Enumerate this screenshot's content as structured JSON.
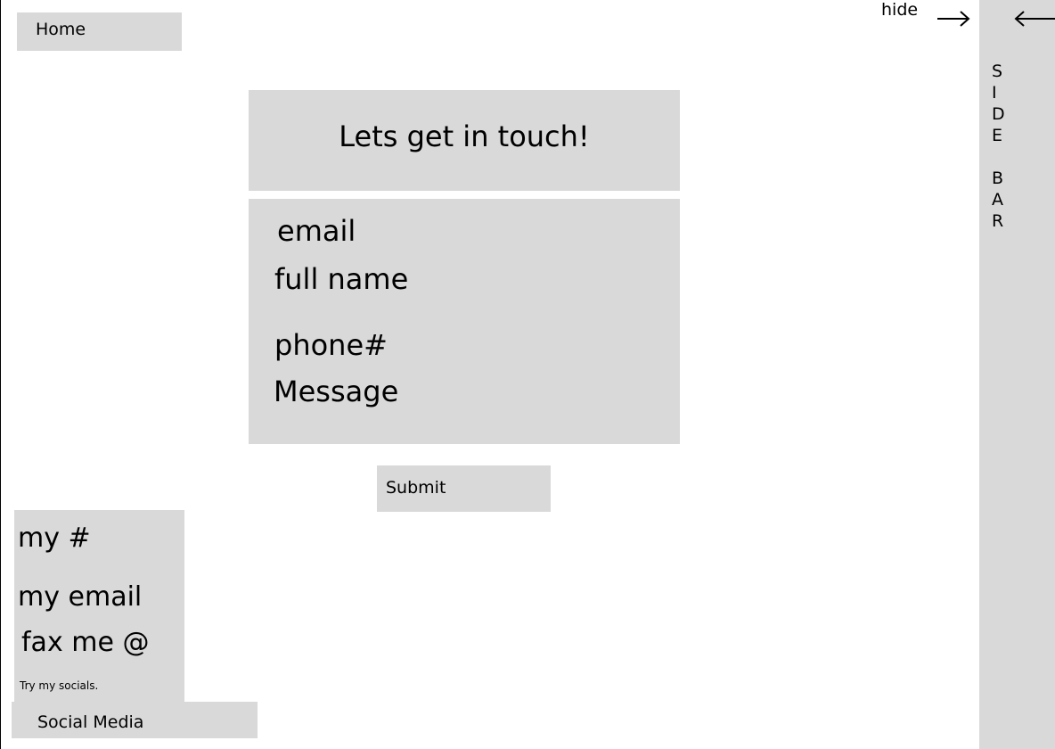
{
  "nav": {
    "home_label": "Home",
    "hide_label": "hide"
  },
  "contact_form": {
    "title": "Lets get in touch!",
    "fields": {
      "email": "email",
      "full_name": "full name",
      "phone": "phone#",
      "message": "Message"
    },
    "submit_label": "Submit"
  },
  "contact_info": {
    "my_number": "my #",
    "my_email": "my email",
    "fax": "fax me @",
    "socials_note": "Try my socials.",
    "social_media_label": "Social Media"
  },
  "sidebar": {
    "letters": [
      "S",
      "I",
      "D",
      "E",
      "",
      "B",
      "A",
      "R"
    ]
  },
  "colors": {
    "panel": "#d9d9d9",
    "background": "#ffffff",
    "text": "#000000"
  },
  "icons": {
    "hide_arrow": "arrow-right-icon",
    "sidebar_arrow": "arrow-left-icon"
  }
}
